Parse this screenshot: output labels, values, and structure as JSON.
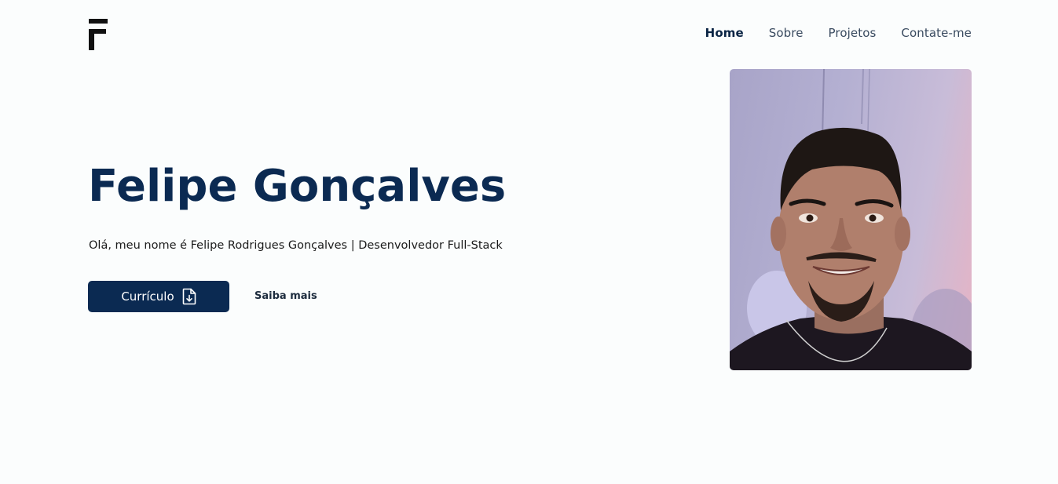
{
  "logo": {
    "icon": "f-logo-icon"
  },
  "nav": {
    "items": [
      {
        "label": "Home",
        "active": true
      },
      {
        "label": "Sobre",
        "active": false
      },
      {
        "label": "Projetos",
        "active": false
      },
      {
        "label": "Contate-me",
        "active": false
      }
    ]
  },
  "hero": {
    "title": "Felipe Gonçalves",
    "subtitle": "Olá, meu nome é Felipe Rodrigues Gonçalves | Desenvolvedor Full-Stack",
    "cv_button_label": "Currículo",
    "cv_button_icon": "file-download-icon",
    "more_link_label": "Saiba mais"
  },
  "photo": {
    "subject": "profile-photo"
  },
  "colors": {
    "primary": "#0b2a52",
    "background": "#fbfdfd",
    "text": "#1a1a1a"
  }
}
